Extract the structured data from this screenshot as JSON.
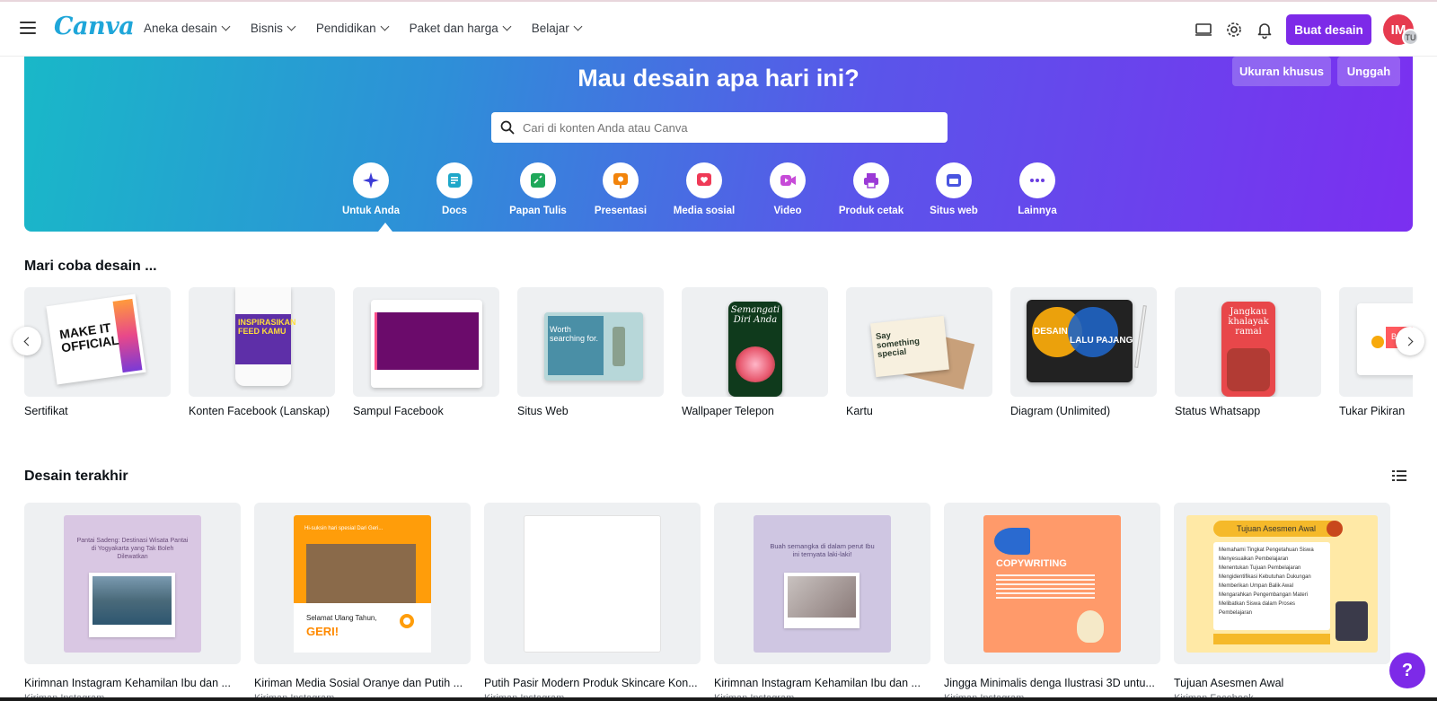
{
  "nav": {
    "logo": "Canva",
    "links": [
      "Aneka desain",
      "Bisnis",
      "Pendidikan",
      "Paket dan harga",
      "Belajar"
    ],
    "create_button": "Buat desain",
    "avatar_initials": "IM",
    "avatar_badge": "TU"
  },
  "hero": {
    "title": "Mau desain apa hari ini?",
    "custom_size_button": "Ukuran khusus",
    "upload_button": "Unggah",
    "search_placeholder": "Cari di konten Anda atau Canva",
    "categories": [
      {
        "label": "Untuk Anda",
        "icon": "sparkle-icon",
        "color": "#3b3bd6"
      },
      {
        "label": "Docs",
        "icon": "docs-icon",
        "color": "#1ea7c9"
      },
      {
        "label": "Papan Tulis",
        "icon": "whiteboard-icon",
        "color": "#1fa85a"
      },
      {
        "label": "Presentasi",
        "icon": "presentation-icon",
        "color": "#f2840c"
      },
      {
        "label": "Media sosial",
        "icon": "heart-icon",
        "color": "#ef3a57"
      },
      {
        "label": "Video",
        "icon": "video-icon",
        "color": "#c74bd8"
      },
      {
        "label": "Produk cetak",
        "icon": "print-icon",
        "color": "#9b3ad6"
      },
      {
        "label": "Situs web",
        "icon": "website-icon",
        "color": "#4a55e0"
      },
      {
        "label": "Lainnya",
        "icon": "more-icon",
        "color": "#6a3de0"
      }
    ]
  },
  "try_design": {
    "title": "Mari coba desain ...",
    "items": [
      "Sertifikat",
      "Konten Facebook (Lanskap)",
      "Sampul Facebook",
      "Situs Web",
      "Wallpaper Telepon",
      "Kartu",
      "Diagram (Unlimited)",
      "Status Whatsapp",
      "Tukar Pikiran"
    ],
    "thumb_texts": {
      "certificate": "MAKE IT OFFICIAL",
      "facebook_content": "INSPIRASIKAN FEED KAMU",
      "website": "Worth searching for.",
      "wallpaper": "Semangati Diri Anda",
      "card": "Say something special",
      "diagram_left": "DESAIN",
      "diagram_right": "LALU PAJANG",
      "whatsapp": "Jangkau khalayak ramai",
      "brainstorm": "Br"
    }
  },
  "recent": {
    "title": "Desain terakhir",
    "items": [
      {
        "label": "Kirimnan Instagram Kehamilan Ibu dan ...",
        "sub": "Kiriman Instagram",
        "bg": "#d9c7e3"
      },
      {
        "label": "Kiriman Media Sosial Oranye dan Putih ...",
        "sub": "Kiriman Instagram",
        "bg": "#ff9d0a"
      },
      {
        "label": "Putih Pasir Modern Produk Skincare Kon...",
        "sub": "Kiriman Instagram",
        "bg": "#ffffff"
      },
      {
        "label": "Kirimnan Instagram Kehamilan Ibu dan ...",
        "sub": "Kiriman Instagram",
        "bg": "#cfc6e2"
      },
      {
        "label": "Jingga Minimalis denga Ilustrasi 3D untu...",
        "sub": "Kiriman Instagram",
        "bg": "#ff9a6a"
      },
      {
        "label": "Tujuan Asesmen Awal",
        "sub": "Kiriman Facebook",
        "bg": "#ffe9a6"
      }
    ],
    "thumb_texts": {
      "pregnancy1": "Pantai Sadeng: Destinasi Wisata Pantai di Yogyakarta yang Tak Boleh Dilewatkan",
      "birthday_top": "Hi-suksin hari spesial Dari Geri...",
      "birthday_greeting": "Selamat Ulang Tahun,",
      "birthday_name": "GERI!",
      "pregnancy2": "Buah semangka di dalam perut Ibu ini ternyata laki-laki!",
      "copywriting": "COPYWRITING",
      "assessment_title": "Tujuan Asesmen Awal",
      "assessment_points": [
        "Memahami Tingkat Pengetahuan Siswa",
        "Menyesuaikan Pembelajaran",
        "Menentukan Tujuan Pembelajaran",
        "Mengidentifikasi Kebutuhan Dukungan",
        "Memberikan Umpan Balik Awal",
        "Mengarahkan Pengembangan Materi",
        "Melibatkan Siswa dalam Proses Pembelajaran"
      ]
    }
  },
  "help_label": "?",
  "colors": {
    "accent": "#7d2ae8",
    "logo": "#1fa6d9"
  }
}
